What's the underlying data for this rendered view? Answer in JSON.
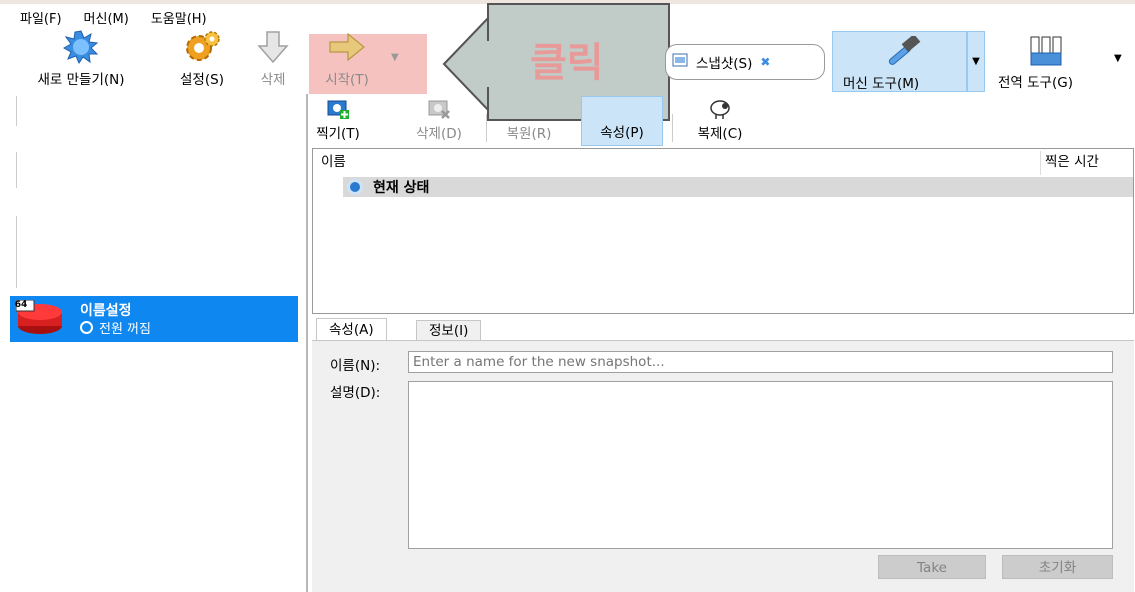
{
  "menu": [
    "파일(F)",
    "머신(M)",
    "도움말(H)"
  ],
  "toolbar": {
    "new_label": "새로 만들기(N)",
    "settings_label": "설정(S)",
    "delete_label": "삭제",
    "start_label": "시작(T)",
    "snapshot_label": "스냅샷(S)",
    "machine_tools_label": "머신 도구(M)",
    "global_tools_label": "전역 도구(G)"
  },
  "callout": {
    "text": "클릭",
    "color": "#e89a98"
  },
  "vm": {
    "badge": "64",
    "name": "이름설정",
    "state": "전원 꺼짐"
  },
  "snapshot_toolbar": {
    "take": "찍기(T)",
    "delete": "삭제(D)",
    "restore": "복원(R)",
    "properties": "속성(P)",
    "clone": "복제(C)"
  },
  "table": {
    "col_name": "이름",
    "col_time": "찍은 시간",
    "current_state": "현재 상태"
  },
  "tabs": {
    "props": "속성(A)",
    "info": "정보(I)"
  },
  "props": {
    "name_label": "이름(N):",
    "name_placeholder": "Enter a name for the new snapshot...",
    "desc_label": "설명(D):",
    "take_button": "Take",
    "reset_button": "초기화"
  },
  "colors": {
    "selection": "#0f87f0",
    "active_tool": "#cce4f7",
    "start_highlight": "#f5c2c0"
  }
}
